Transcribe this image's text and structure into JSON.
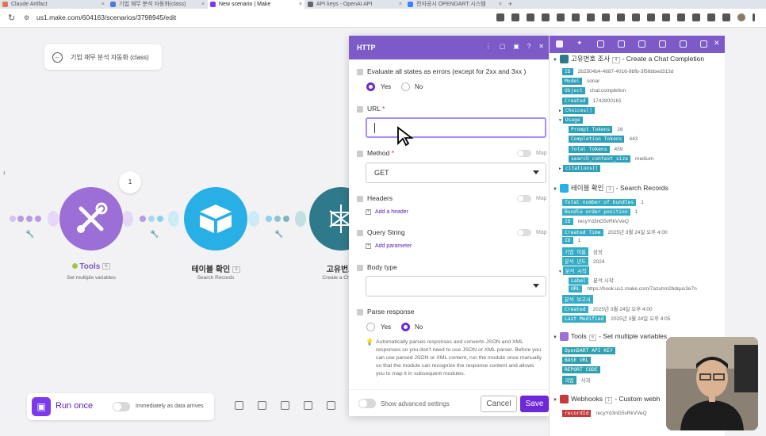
{
  "browser": {
    "tabs": [
      {
        "label": "Claude Artifact",
        "color": "#d97757"
      },
      {
        "label": "기업 재무 분석 자동화(class)",
        "color": "#4a7dd8"
      },
      {
        "label": "New scenario | Make",
        "color": "#7c3aed"
      },
      {
        "label": "API keys - OpenAI API",
        "color": "#666666"
      },
      {
        "label": "전자공시 OPENDART 시스템",
        "color": "#3b82f6"
      }
    ],
    "url": "us1.make.com/604163/scenarios/3798945/edit"
  },
  "scenario": {
    "title": "기업 재무 분석 자동화 (class)"
  },
  "nodes": [
    {
      "name": "Tools",
      "number": "6",
      "sub": "Set multiple variables",
      "color": "#9b6fd6"
    },
    {
      "name": "테이블 확인",
      "number": "3",
      "sub": "Search Records",
      "color": "#28b0e6"
    },
    {
      "name": "고유번호",
      "number": "",
      "sub": "Create a Chat C",
      "color": "#2f7a8a"
    }
  ],
  "node_counter": "1",
  "runbar": {
    "run_label": "Run once",
    "immediately_label": "Immediately as data arrives"
  },
  "http_panel": {
    "title": "HTTP",
    "evaluate_label": "Evaluate all states as errors (except for 2xx and 3xx )",
    "yes": "Yes",
    "no": "No",
    "url_label": "URL",
    "url_required": "*",
    "method_label": "Method",
    "method_required": "*",
    "method_value": "GET",
    "map": "Map",
    "headers_label": "Headers",
    "add_header": "Add a header",
    "query_label": "Query String",
    "add_parameter": "Add parameter",
    "body_label": "Body type",
    "parse_label": "Parse response",
    "help_text": "Automatically parses responses and converts JSON and XML responses so you don't need to use JSON or XML parser. Before you can use parsed JSON or XML content, run the module once manually so that the module can recognize the response content and allows you to map it in subsequent modules.",
    "advanced_label": "Show advanced settings",
    "cancel": "Cancel",
    "save": "Save"
  },
  "output_panel": {
    "section1": {
      "title": "고유번호 조사",
      "num": "4",
      "sub": "- Create a Chat Completion"
    },
    "section1_rows": [
      {
        "key": "ID",
        "val": "2b2504b4-4687-4016-9bfb-3f56bbed313d"
      },
      {
        "key": "Model",
        "val": "sonar"
      },
      {
        "key": "Object",
        "val": "chat.completion"
      },
      {
        "key": "Created",
        "val": "1742800161"
      },
      {
        "key": "Choices[]",
        "val": ""
      },
      {
        "key": "Usage",
        "val": ""
      },
      {
        "key": "Prompt Tokens",
        "val": "16"
      },
      {
        "key": "Completion Tokens",
        "val": "443"
      },
      {
        "key": "Total Tokens",
        "val": "459"
      },
      {
        "key": "search_context_size",
        "val": "medium"
      },
      {
        "key": "citations[]",
        "val": ""
      }
    ],
    "section2": {
      "title": "테이블 확인",
      "num": "3",
      "sub": "- Search Records"
    },
    "section2_rows": [
      {
        "key": "Total number of bundles",
        "val": "1"
      },
      {
        "key": "Bundle order position",
        "val": "1"
      },
      {
        "key": "ID",
        "val": "recyYd3nG5vRkVVeQ"
      },
      {
        "key": "Created Time",
        "val": "2025년 3월 24일 오후 4:00"
      },
      {
        "key": "ID",
        "val": "1"
      },
      {
        "key": "기업 이름",
        "val": "삼성"
      },
      {
        "key": "분석 년도",
        "val": "2024"
      },
      {
        "key": "분석 시작",
        "val": ""
      },
      {
        "key": "Label",
        "val": "분석 시작"
      },
      {
        "key": "URL",
        "val": "https://hook.us1.make.com/7azuhm2bdqus3e7n"
      },
      {
        "key": "분석 보고서",
        "val": ""
      },
      {
        "key": "Created",
        "val": "2025년 3월 24일 오후 4:00"
      },
      {
        "key": "Last Modified",
        "val": "2025년 3월 24일 오후 4:05"
      }
    ],
    "section3": {
      "title": "Tools",
      "num": "6",
      "sub": "- Set multiple variables"
    },
    "section3_rows": [
      {
        "key": "OpenDART API KEY",
        "val": ""
      },
      {
        "key": "BASE URL",
        "val": ""
      },
      {
        "key": "REPORT CODE",
        "val": ""
      },
      {
        "key": "과업",
        "val": "사과"
      }
    ],
    "section4": {
      "title": "Webhooks",
      "num": "1",
      "sub": "- Custom webh"
    },
    "section4_rows": [
      {
        "key": "recordId",
        "val": "recyYd3nG5vRkVVeQ"
      }
    ]
  }
}
